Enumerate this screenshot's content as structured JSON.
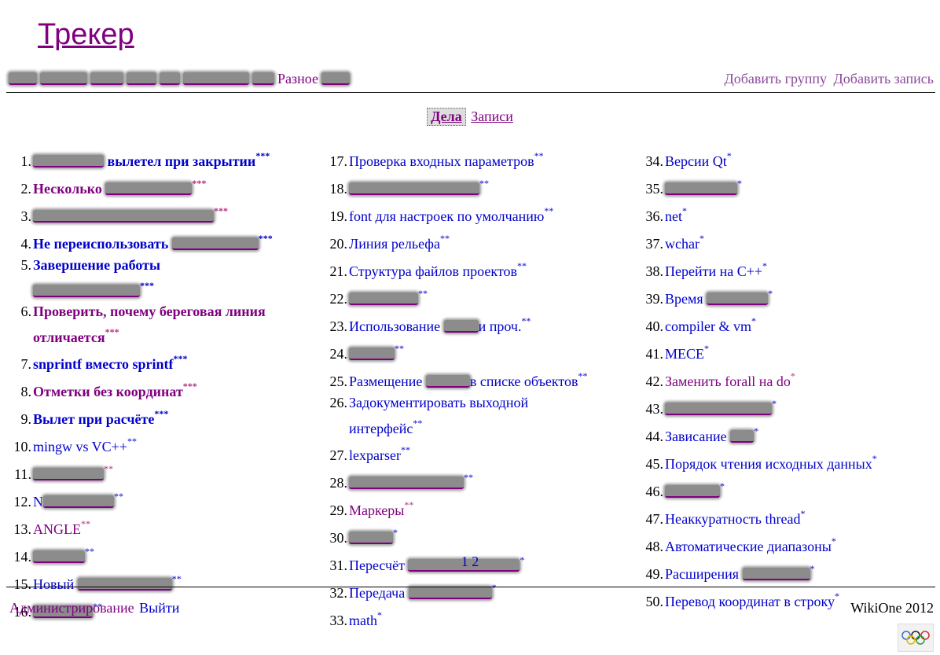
{
  "title": "Трекер",
  "nav": {
    "groups": [
      {
        "label": "",
        "width": 36
      },
      {
        "label": "",
        "width": 60
      },
      {
        "label": "",
        "width": 42
      },
      {
        "label": "",
        "width": 38
      },
      {
        "label": "",
        "width": 26
      },
      {
        "label": "",
        "width": 84
      },
      {
        "label": "",
        "width": 28
      },
      {
        "label": "Разное"
      },
      {
        "label": "",
        "width": 36
      }
    ],
    "add_group": "Добавить группу",
    "add_record": "Добавить запись"
  },
  "tabs": {
    "active": "Дела",
    "other": "Записи"
  },
  "columns": [
    [
      {
        "n": "1.",
        "pre": "",
        "preW": 90,
        "text": " вылетел при закрытии",
        "stars": "***",
        "bold": true
      },
      {
        "n": "2.",
        "text": "Несколько ",
        "post": "",
        "postW": 110,
        "stars": "***",
        "bold": true,
        "visited": true
      },
      {
        "n": "3.",
        "pre": "",
        "preW": 230,
        "text": "",
        "stars": "***",
        "bold": true,
        "visited": true
      },
      {
        "n": "4.",
        "text": "Не переиспользовать ",
        "post": "",
        "postW": 110,
        "stars": "***",
        "bold": true
      },
      {
        "n": "5.",
        "wrap": true,
        "text": "Завершение работы",
        "line2pre": "",
        "line2W": 136,
        "stars": "***",
        "bold": true
      },
      {
        "n": "6.",
        "wrap": true,
        "text": "Проверить, почему береговая линия",
        "line2": "отличается",
        "stars": "***",
        "bold": true,
        "visited": true
      },
      {
        "n": "7.",
        "text": "snprintf вместо sprintf",
        "stars": "***",
        "bold": true
      },
      {
        "n": "8.",
        "text": "Отметки без координат",
        "stars": "***",
        "bold": true,
        "visited": true
      },
      {
        "n": "9.",
        "text": "Вылет при расчёте",
        "stars": "***",
        "bold": true
      },
      {
        "n": "10.",
        "text": "mingw vs VC++",
        "stars": "**"
      },
      {
        "n": "11.",
        "pre": "",
        "preW": 90,
        "text": "",
        "stars": "**",
        "visited": true
      },
      {
        "n": "12.",
        "text": "N",
        "post": "",
        "postW": 90,
        "stars": "**"
      },
      {
        "n": "13.",
        "text": "ANGLE",
        "stars": "**",
        "visited": true
      },
      {
        "n": "14.",
        "pre": "",
        "preW": 66,
        "text": "",
        "stars": "**"
      },
      {
        "n": "15.",
        "text": "Новый ",
        "post": "",
        "postW": 120,
        "stars": "**"
      },
      {
        "n": "16.",
        "pre": "",
        "preW": 76,
        "text": "",
        "stars": "**"
      }
    ],
    [
      {
        "n": "17.",
        "text": "Проверка входных параметров",
        "stars": "**"
      },
      {
        "n": "18.",
        "pre": "",
        "preW": 166,
        "text": "",
        "stars": "**"
      },
      {
        "n": "19.",
        "text": "font для настроек по умолчанию",
        "stars": "**"
      },
      {
        "n": "20.",
        "text": "Линия рельефа",
        "stars": "**"
      },
      {
        "n": "21.",
        "text": "Структура файлов проектов",
        "stars": "**"
      },
      {
        "n": "22.",
        "pre": "",
        "preW": 88,
        "text": "",
        "stars": "**"
      },
      {
        "n": "23.",
        "text": "Использование ",
        "post": "",
        "postW": 44,
        "text2": "и проч.",
        "stars": "**"
      },
      {
        "n": "24.",
        "pre": "",
        "preW": 58,
        "text": "",
        "stars": "**"
      },
      {
        "n": "25.",
        "text": "Размещение ",
        "post": "",
        "postW": 56,
        "text2": "в списке объектов",
        "stars": "**"
      },
      {
        "n": "26.",
        "wrap": true,
        "text": "Задокументировать выходной",
        "line2": "интерфейс",
        "stars": "**"
      },
      {
        "n": "27.",
        "text": "lexparser",
        "stars": "**"
      },
      {
        "n": "28.",
        "pre": "",
        "preW": 146,
        "text": "",
        "stars": "**"
      },
      {
        "n": "29.",
        "text": "Маркеры",
        "stars": "**",
        "visited": true
      },
      {
        "n": "30.",
        "pre": "",
        "preW": 56,
        "text": "",
        "stars": "*"
      },
      {
        "n": "31.",
        "text": "Пересчёт ",
        "post": "",
        "postW": 142,
        "stars": "*"
      },
      {
        "n": "32.",
        "text": "Передача ",
        "post": "",
        "postW": 106,
        "stars": "*"
      },
      {
        "n": "33.",
        "text": "math",
        "stars": "*"
      }
    ],
    [
      {
        "n": "34.",
        "text": "Версии Qt",
        "stars": "*"
      },
      {
        "n": "35.",
        "pre": "",
        "preW": 92,
        "text": "",
        "stars": "*"
      },
      {
        "n": "36.",
        "text": "net",
        "stars": "*"
      },
      {
        "n": "37.",
        "text": "wchar",
        "stars": "*"
      },
      {
        "n": "38.",
        "text": "Перейти на C++",
        "stars": "*"
      },
      {
        "n": "39.",
        "text": "Время ",
        "post": "",
        "postW": 78,
        "stars": "*"
      },
      {
        "n": "40.",
        "text": "compiler & vm",
        "stars": "*"
      },
      {
        "n": "41.",
        "text": "MECE",
        "stars": "*"
      },
      {
        "n": "42.",
        "text": "Заменить forall на do",
        "stars": "*",
        "visited": true
      },
      {
        "n": "43.",
        "pre": "",
        "preW": 136,
        "text": "",
        "stars": "*"
      },
      {
        "n": "44.",
        "text": "Зависание ",
        "post": "",
        "postW": 30,
        "stars": "*"
      },
      {
        "n": "45.",
        "text": "Порядок чтения исходных данных",
        "stars": "*"
      },
      {
        "n": "46.",
        "pre": "",
        "preW": 70,
        "text": "",
        "stars": "*"
      },
      {
        "n": "47.",
        "text": "Неаккуратность thread",
        "stars": "*"
      },
      {
        "n": "48.",
        "text": "Автоматические диапазоны",
        "stars": "*"
      },
      {
        "n": "49.",
        "text": "Расширения ",
        "post": "",
        "postW": 86,
        "stars": "*"
      },
      {
        "n": "50.",
        "text": "Перевод координат в строку",
        "stars": "*"
      }
    ]
  ],
  "pager": [
    "1",
    "2"
  ],
  "footer": {
    "admin": "Администрирование",
    "logout": "Выйти",
    "copyright": "WikiOne 2012"
  }
}
